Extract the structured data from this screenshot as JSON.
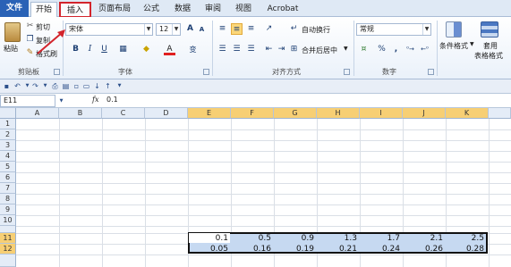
{
  "tabs": [
    {
      "label": "文件",
      "left": 0
    },
    {
      "label": "开始"
    },
    {
      "label": "插入"
    },
    {
      "label": "页面布局"
    },
    {
      "label": "公式"
    },
    {
      "label": "数据"
    },
    {
      "label": "审阅"
    },
    {
      "label": "视图"
    },
    {
      "label": "Acrobat"
    }
  ],
  "ribbon": {
    "clipboard": {
      "paste": "粘贴",
      "cut": "剪切",
      "copy": "复制",
      "format_painter": "格式刷",
      "group": "剪贴板"
    },
    "font": {
      "font_name": "宋体",
      "font_size": "12",
      "grow": "A",
      "shrink": "A",
      "bold": "B",
      "italic": "I",
      "underline": "U",
      "font_color": "A",
      "phonetic": "变",
      "group": "字体"
    },
    "alignment": {
      "wrap_text": "自动换行",
      "merge_center": "合并后居中",
      "group": "对齐方式"
    },
    "number": {
      "format": "常规",
      "percent": "%",
      "comma": ",",
      "group": "数字"
    },
    "styles": {
      "conditional": "条件格式",
      "table_format_1": "套用",
      "table_format_2": "表格格式"
    }
  },
  "formula_bar": {
    "name_box": "E11",
    "fx": "fx",
    "value": "0.1"
  },
  "columns": [
    "A",
    "B",
    "C",
    "D",
    "E",
    "F",
    "G",
    "H",
    "I",
    "J",
    "K"
  ],
  "rows": [
    "1",
    "2",
    "3",
    "4",
    "5",
    "6",
    "7",
    "8",
    "9",
    "10",
    "11",
    "12"
  ],
  "row11": [
    "0.1",
    "0.5",
    "0.9",
    "1.3",
    "1.7",
    "2.1",
    "2.5"
  ],
  "row12": [
    "0.05",
    "0.16",
    "0.19",
    "0.21",
    "0.24",
    "0.26",
    "0.28"
  ],
  "colors": {
    "file_tab": "#2a62b6",
    "selection_fill": "#c6d9f1",
    "header_highlight": "#f7cf74",
    "annotation_red": "#d3242c"
  }
}
